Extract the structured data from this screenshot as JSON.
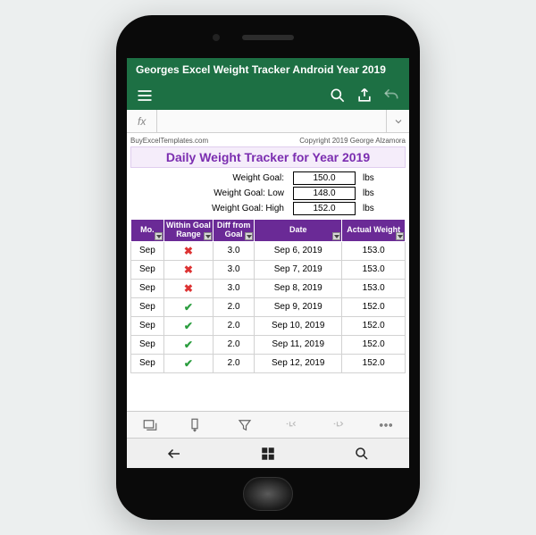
{
  "titlebar": "Georges Excel Weight Tracker Android Year 2019",
  "fx": {
    "label": "fx"
  },
  "meta": {
    "site": "BuyExcelTemplates.com",
    "copyright": "Copyright 2019 George Alzamora"
  },
  "sheet_title": "Daily Weight Tracker for Year 2019",
  "goals": {
    "row1": {
      "label": "Weight Goal:",
      "value": "150.0",
      "unit": "lbs"
    },
    "row2": {
      "label": "Weight Goal: Low",
      "value": "148.0",
      "unit": "lbs"
    },
    "row3": {
      "label": "Weight Goal: High",
      "value": "152.0",
      "unit": "lbs"
    }
  },
  "columns": {
    "mo": "Mo.",
    "within": "Within Goal Range",
    "diff": "Diff from Goal",
    "date": "Date",
    "actual": "Actual Weight"
  },
  "rows": [
    {
      "mo": "Sep",
      "mark": "✖",
      "markClass": "mark-x",
      "diff": "3.0",
      "date": "Sep 6, 2019",
      "actual": "153.0"
    },
    {
      "mo": "Sep",
      "mark": "✖",
      "markClass": "mark-x",
      "diff": "3.0",
      "date": "Sep 7, 2019",
      "actual": "153.0"
    },
    {
      "mo": "Sep",
      "mark": "✖",
      "markClass": "mark-x",
      "diff": "3.0",
      "date": "Sep 8, 2019",
      "actual": "153.0"
    },
    {
      "mo": "Sep",
      "mark": "✔",
      "markClass": "mark-v",
      "diff": "2.0",
      "date": "Sep 9, 2019",
      "actual": "152.0"
    },
    {
      "mo": "Sep",
      "mark": "✔",
      "markClass": "mark-v",
      "diff": "2.0",
      "date": "Sep 10, 2019",
      "actual": "152.0"
    },
    {
      "mo": "Sep",
      "mark": "✔",
      "markClass": "mark-v",
      "diff": "2.0",
      "date": "Sep 11, 2019",
      "actual": "152.0"
    },
    {
      "mo": "Sep",
      "mark": "✔",
      "markClass": "mark-v",
      "diff": "2.0",
      "date": "Sep 12, 2019",
      "actual": "152.0"
    }
  ]
}
